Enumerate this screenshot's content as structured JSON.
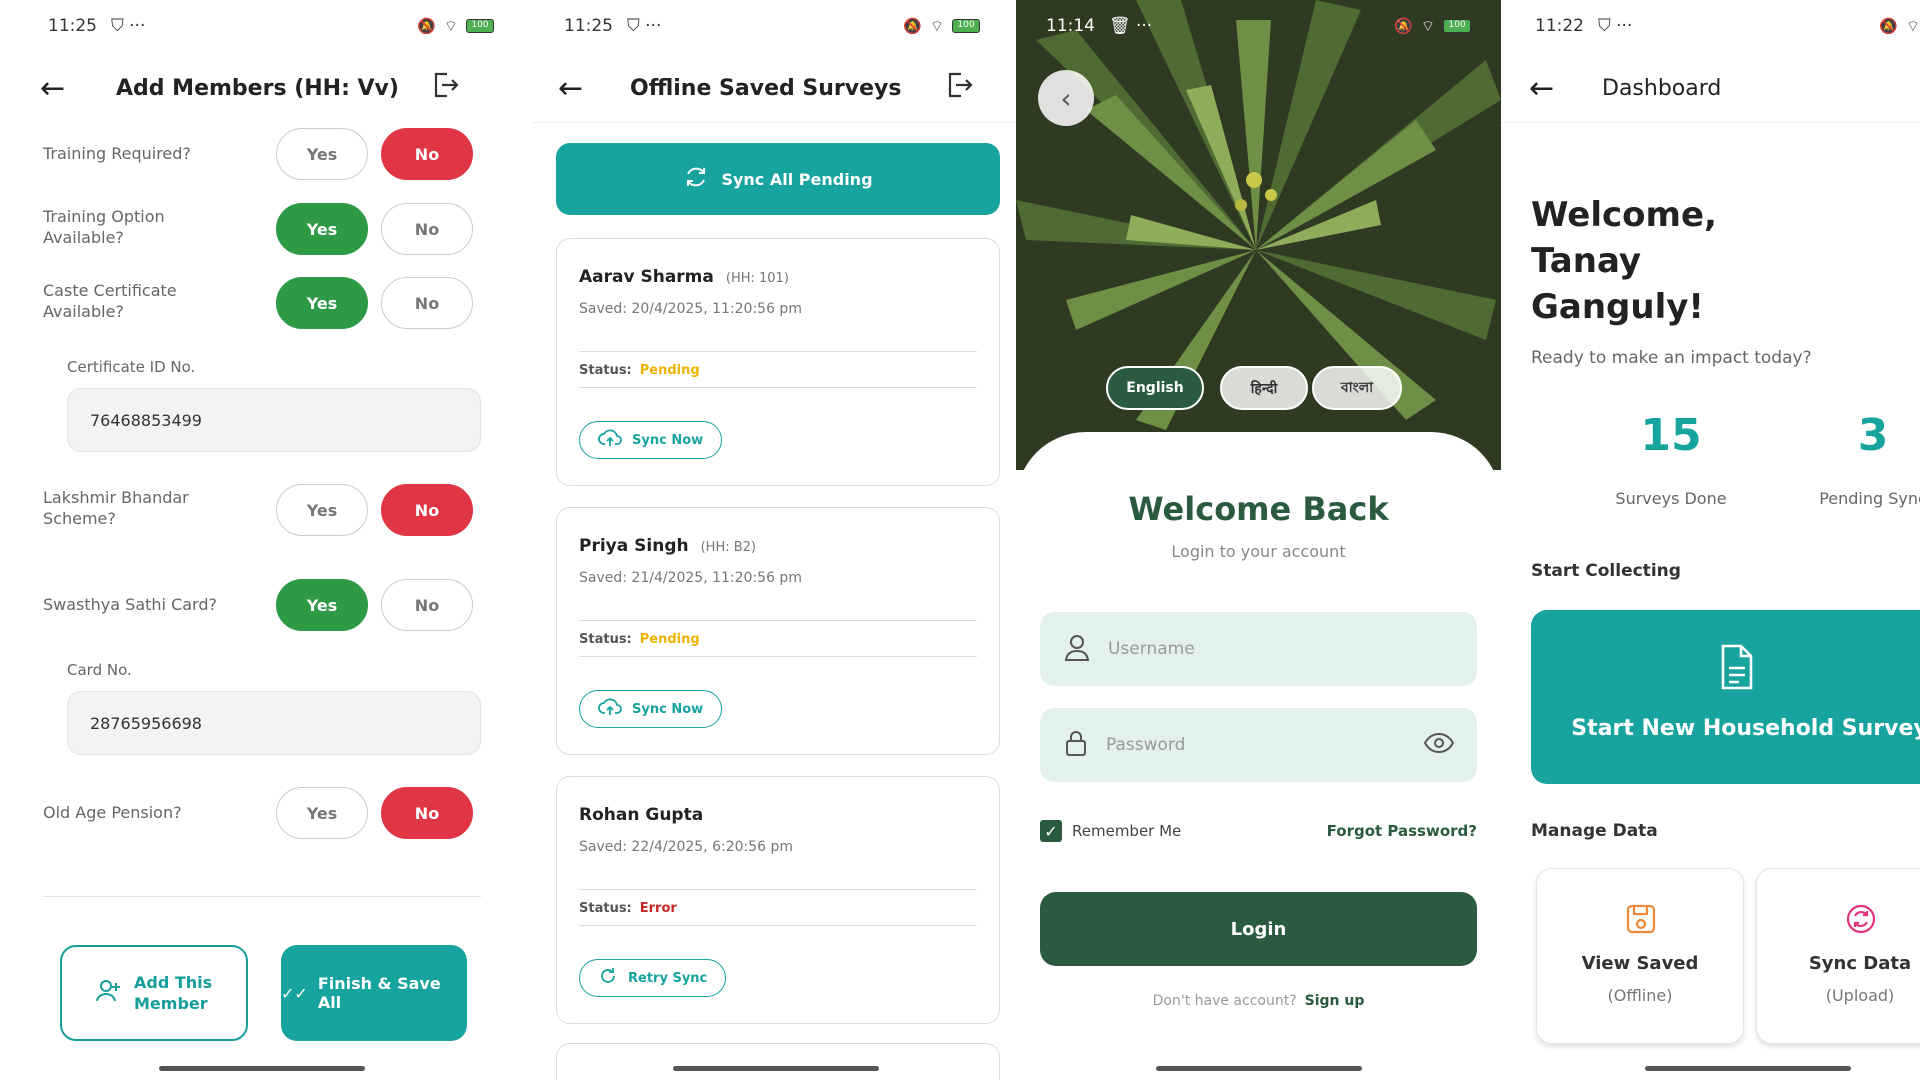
{
  "colors": {
    "teal": "#17a39e",
    "green": "#2e9a46",
    "red": "#e03545",
    "forest": "#2a5b3f",
    "pending": "#f0b400",
    "error": "#c62828"
  },
  "screen1": {
    "time": "11:25",
    "battery": "100",
    "title": "Add Members (HH: Vv)",
    "yes_label": "Yes",
    "no_label": "No",
    "questions": [
      {
        "label": "Training Required?",
        "selected": "No"
      },
      {
        "label": "Training Option Available?",
        "selected": "Yes"
      },
      {
        "label": "Caste Certificate Available?",
        "selected": "Yes"
      },
      {
        "label": "Lakshmir Bhandar Scheme?",
        "selected": "No"
      },
      {
        "label": "Swasthya Sathi Card?",
        "selected": "Yes"
      },
      {
        "label": "Old Age Pension?",
        "selected": "No"
      }
    ],
    "certificate_label": "Certificate ID No.",
    "certificate_value": "76468853499",
    "card_label": "Card No.",
    "card_value": "28765956698",
    "add_member_label": "Add This Member",
    "finish_label": "Finish & Save All"
  },
  "screen2": {
    "time": "11:25",
    "battery": "100",
    "title": "Offline Saved Surveys",
    "sync_all_label": "Sync All Pending",
    "status_label": "Status:",
    "cards": [
      {
        "name": "Aarav Sharma",
        "hh": "(HH: 101)",
        "saved": "Saved: 20/4/2025, 11:20:56 pm",
        "status": "Pending",
        "action": "Sync Now"
      },
      {
        "name": "Priya Singh",
        "hh": "(HH: B2)",
        "saved": "Saved: 21/4/2025, 11:20:56 pm",
        "status": "Pending",
        "action": "Sync Now"
      },
      {
        "name": "Rohan Gupta",
        "hh": "",
        "saved": "Saved: 22/4/2025, 6:20:56 pm",
        "status": "Error",
        "action": "Retry Sync"
      }
    ]
  },
  "screen3": {
    "time": "11:14",
    "battery": "100",
    "languages": [
      "English",
      "हिन्दी",
      "বাংলা"
    ],
    "welcome": "Welcome Back",
    "subtitle": "Login to your account",
    "username_placeholder": "Username",
    "password_placeholder": "Password",
    "remember_label": "Remember Me",
    "forgot_label": "Forgot Password?",
    "login_label": "Login",
    "no_account": "Don't have account?",
    "signup_label": "Sign up"
  },
  "screen4": {
    "time": "11:22",
    "title": "Dashboard",
    "greeting": "Welcome, Tanay Ganguly!",
    "ready": "Ready to make an impact today?",
    "surveys_done": "15",
    "surveys_done_label": "Surveys Done",
    "pending_sync": "3",
    "pending_sync_label": "Pending Sync",
    "start_collecting": "Start Collecting",
    "start_survey_label": "Start New Household Survey",
    "manage_data": "Manage Data",
    "view_saved_title": "View Saved",
    "view_saved_sub": "(Offline)",
    "sync_data_title": "Sync Data",
    "sync_data_sub": "(Upload)"
  }
}
